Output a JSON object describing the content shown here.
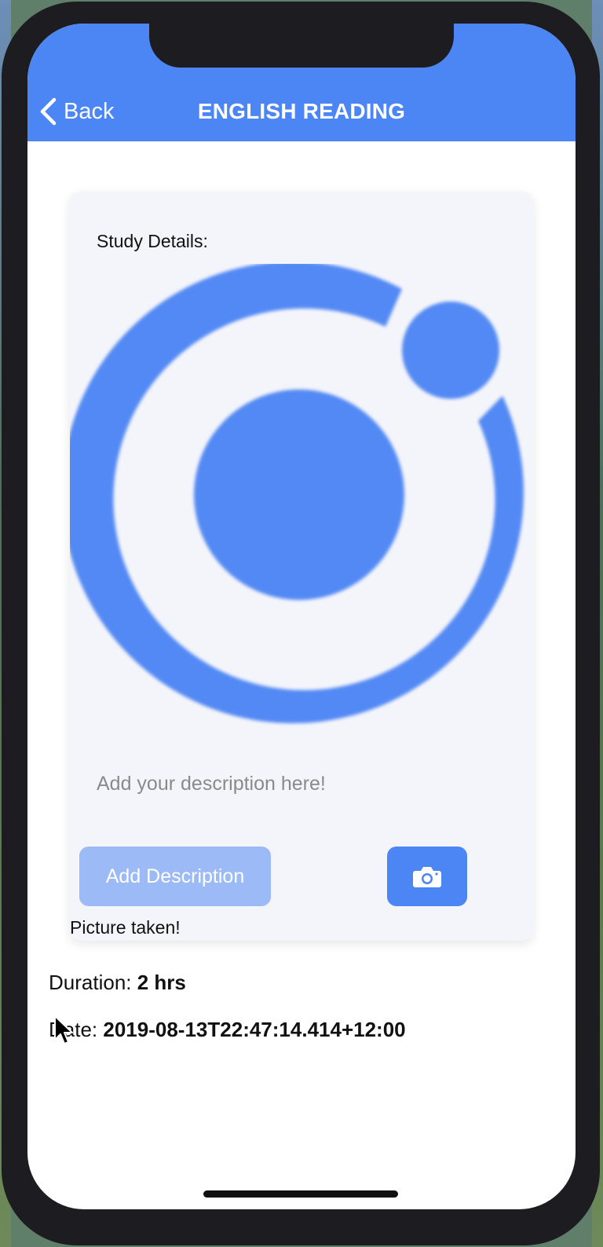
{
  "header": {
    "back_label": "Back",
    "title": "ENGLISH READING"
  },
  "card": {
    "title": "Study Details:",
    "description_placeholder": "Add your description here!",
    "add_description_label": "Add Description",
    "picture_status": "Picture taken!"
  },
  "details": {
    "duration_label": "Duration:",
    "duration_value": "2 hrs",
    "date_label": "Date:",
    "date_value": "2019-08-13T22:47:14.414+12:00"
  },
  "icons": {
    "back": "chevron-left-icon",
    "camera": "camera-icon",
    "logo": "ionic-logo"
  },
  "colors": {
    "primary": "#4c86f5",
    "primary_light": "#9bbaf6",
    "card_bg": "#f4f5fa"
  }
}
